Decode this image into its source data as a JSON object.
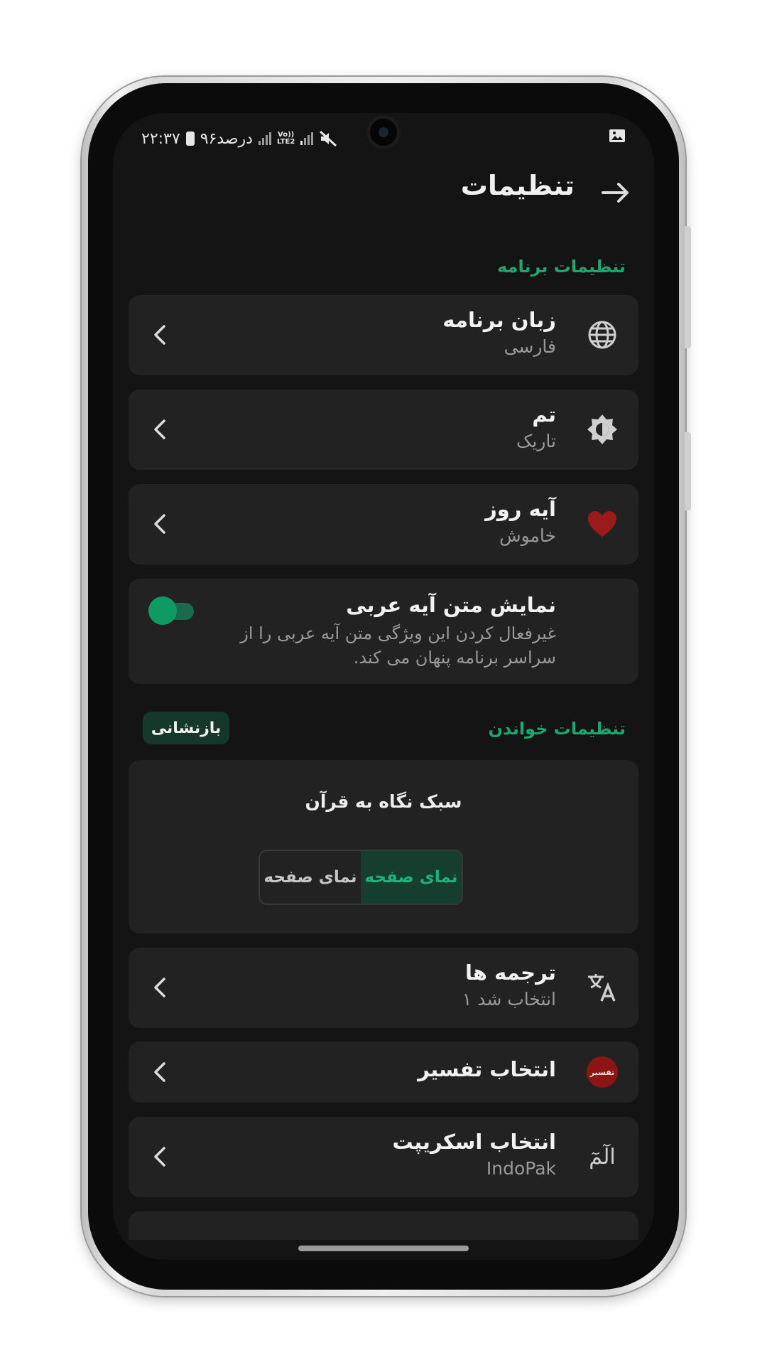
{
  "status_bar": {
    "time": "۲۲:۳۷",
    "battery_text": "۹۶درصد",
    "network_type": "LTE2",
    "volte": "Vo))",
    "icons": [
      "battery-icon",
      "signal-icon",
      "mute-icon",
      "gallery-icon"
    ]
  },
  "header": {
    "title": "تنظیمات",
    "back_icon": "arrow-right-icon"
  },
  "app_settings": {
    "section_title": "تنظیمات برنامه",
    "language": {
      "title": "زبان برنامه",
      "value": "فارسی",
      "icon": "globe-icon"
    },
    "theme": {
      "title": "تم",
      "value": "تاریک",
      "icon": "brightness-icon"
    },
    "daily_verse": {
      "title": "آیه روز",
      "value": "خاموش",
      "icon": "heart-icon"
    },
    "arabic_text": {
      "title": "نمایش متن آیه عربی",
      "description": "غیرفعال کردن این ویژگی متن آیه عربی را از سراسر برنامه پنهان می کند.",
      "enabled": true
    }
  },
  "reading_settings": {
    "section_title": "تنظیمات خواندن",
    "reset_label": "بازنشانی",
    "view_style": {
      "title": "سبک نگاه به قرآن",
      "options": [
        "نمای صفحه",
        "نمای صفحه"
      ],
      "selected_index": 0
    },
    "translations": {
      "title": "ترجمه ها",
      "value": "۱ انتخاب شد",
      "icon": "translate-icon"
    },
    "tafsir": {
      "title": "انتخاب تفسیر",
      "icon_text": "تفسیر",
      "icon": "tafsir-badge-icon"
    },
    "script": {
      "title": "انتخاب اسکریپت",
      "value": "IndoPak",
      "icon_text": "الٓمٓ",
      "icon": "script-icon"
    }
  },
  "colors": {
    "accent": "#1fa66e",
    "background": "#141414",
    "card": "#222222",
    "heart": "#9b1b1b"
  }
}
